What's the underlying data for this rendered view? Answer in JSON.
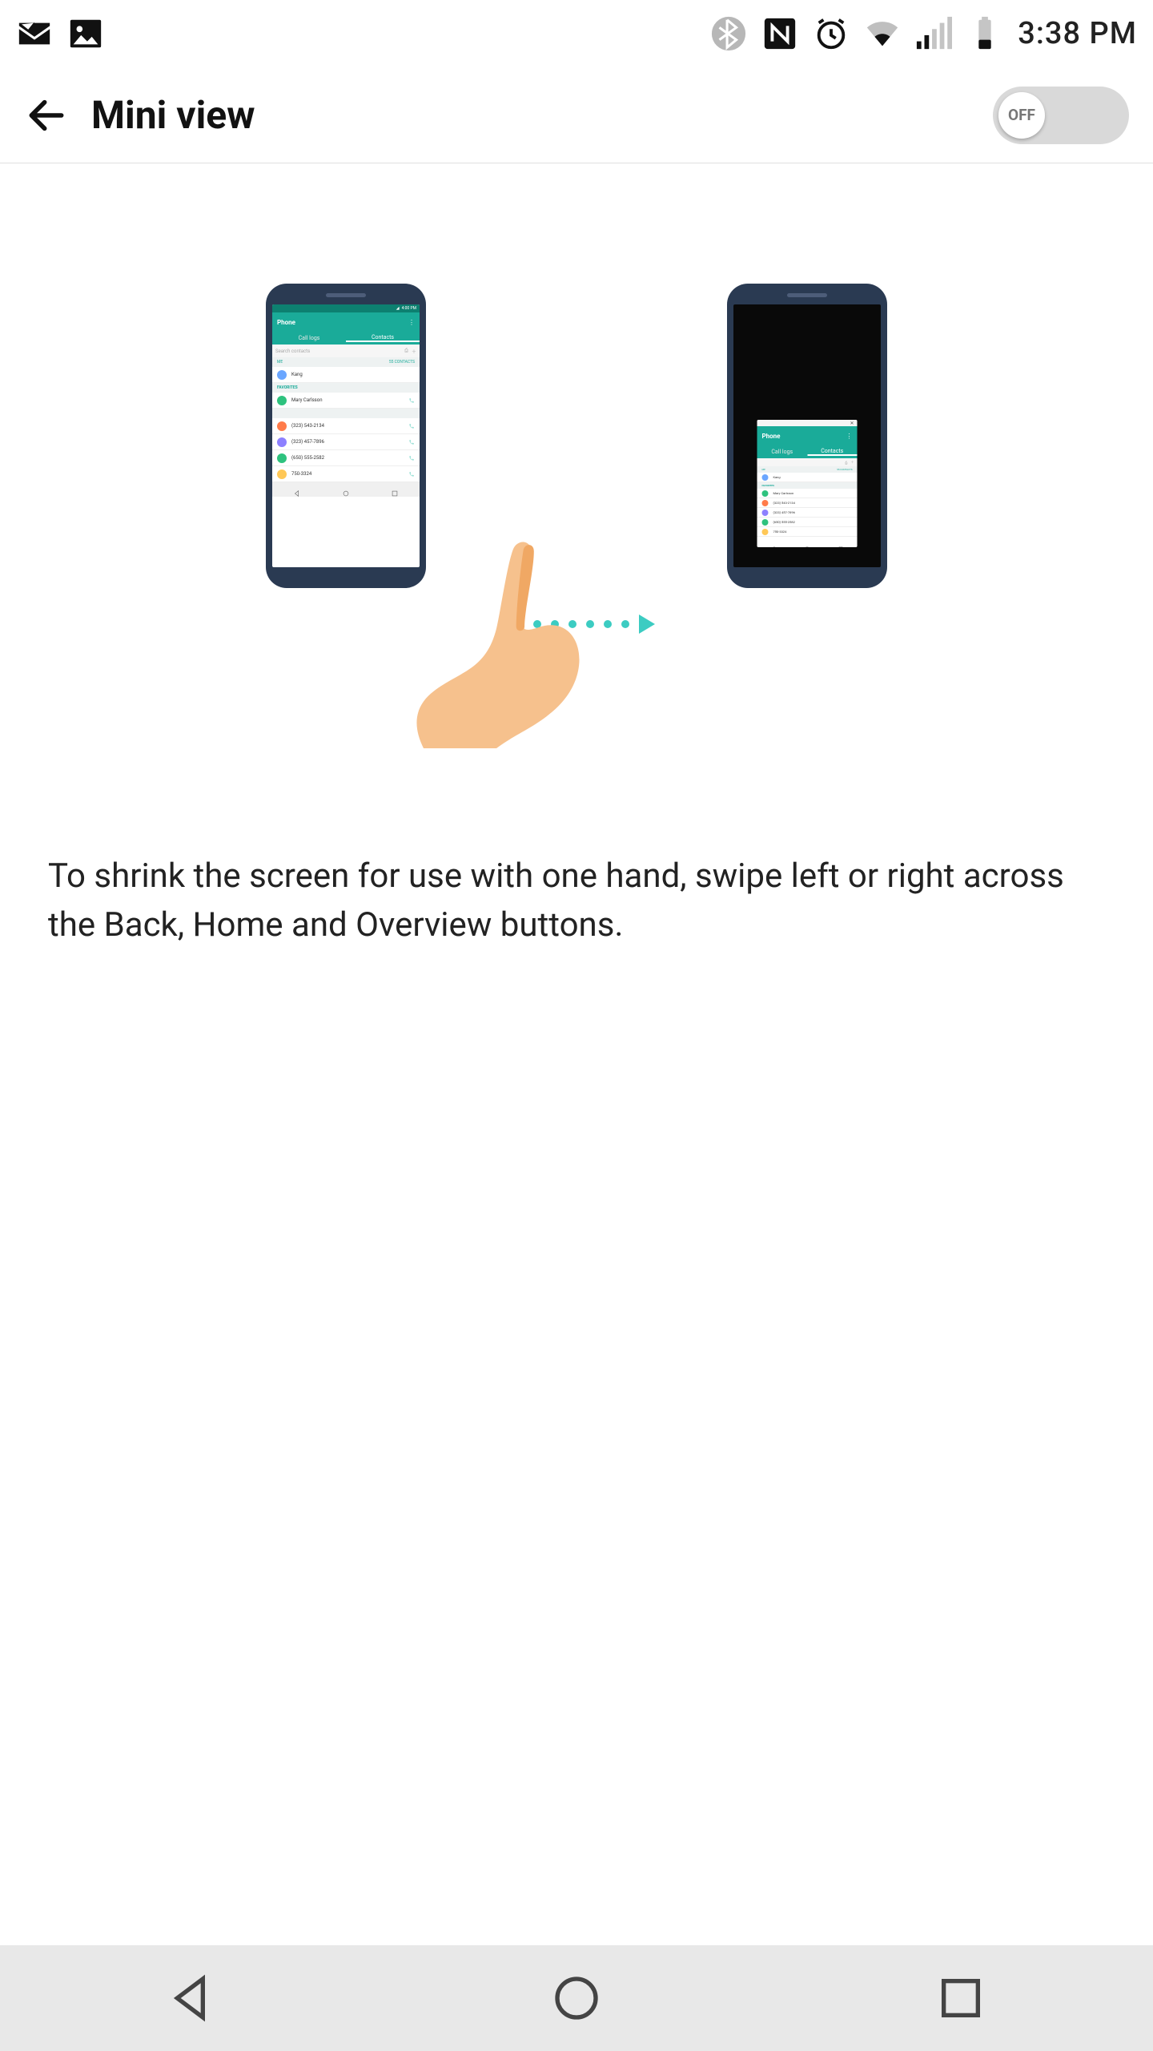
{
  "statusbar": {
    "time": "3:38 PM"
  },
  "header": {
    "title": "Mini view",
    "toggle_label": "OFF",
    "toggle_on": false
  },
  "description": "To shrink the screen for use with one hand, swipe left or right across the Back, Home and Overview buttons.",
  "mock_app": {
    "title": "Phone",
    "time": "4:00 PM",
    "tabs": {
      "left": "Call logs",
      "right": "Contacts"
    },
    "search_placeholder": "Search contacts",
    "count_left": "ME",
    "count_right": "55 CONTACTS",
    "section1": "FAVORITES",
    "section2": "",
    "items": [
      {
        "name": "Kang",
        "color": "#6aa6ff"
      },
      {
        "name": "Mary Carlsson",
        "color": "#2ec27e"
      },
      {
        "name": "(323) 543-2134",
        "color": "#ff7b4a"
      },
      {
        "name": "(323) 457-7896",
        "color": "#8d80ff"
      },
      {
        "name": "(650) 555-2582",
        "color": "#2ec27e"
      },
      {
        "name": "750-3324",
        "color": "#ffc857"
      }
    ]
  },
  "icons": {
    "mail": "mail-icon",
    "image": "image-icon",
    "bluetooth": "bluetooth-icon",
    "nfc": "nfc-icon",
    "alarm": "alarm-icon",
    "wifi": "wifi-icon",
    "signal": "signal-icon",
    "battery": "battery-icon",
    "back": "back-icon",
    "home": "home-icon",
    "overview": "overview-icon",
    "arrow_back": "back-arrow-icon"
  }
}
